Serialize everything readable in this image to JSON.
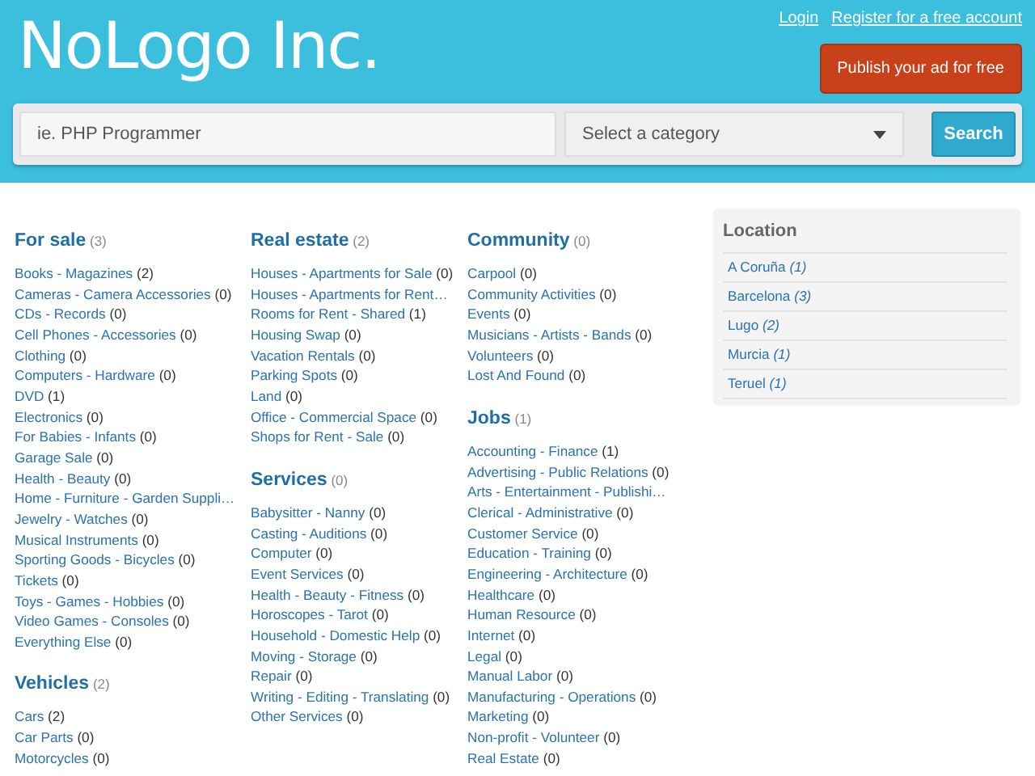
{
  "header": {
    "logo": "NoLogo Inc.",
    "links": [
      "Login",
      "Register for a free account"
    ],
    "publish_button": "Publish your ad for free"
  },
  "search": {
    "placeholder": "ie. PHP Programmer",
    "category": "Select a category",
    "button": "Search"
  },
  "columns": [
    {
      "sections": [
        {
          "title": "For sale",
          "count": "(3)",
          "items": [
            {
              "label": "Books - Magazines",
              "count": "(2)"
            },
            {
              "label": "Cameras - Camera Accessories",
              "count": "(0)"
            },
            {
              "label": "CDs - Records",
              "count": "(0)"
            },
            {
              "label": "Cell Phones - Accessories",
              "count": "(0)"
            },
            {
              "label": "Clothing",
              "count": "(0)"
            },
            {
              "label": "Computers - Hardware",
              "count": "(0)"
            },
            {
              "label": "DVD",
              "count": "(1)"
            },
            {
              "label": "Electronics",
              "count": "(0)"
            },
            {
              "label": "For Babies - Infants",
              "count": "(0)"
            },
            {
              "label": "Garage Sale",
              "count": "(0)"
            },
            {
              "label": "Health - Beauty",
              "count": "(0)"
            },
            {
              "label": "Home - Furniture - Garden Suppli…"
            },
            {
              "label": "Jewelry - Watches",
              "count": "(0)"
            },
            {
              "label": "Musical Instruments",
              "count": "(0)"
            },
            {
              "label": "Sporting Goods - Bicycles",
              "count": "(0)"
            },
            {
              "label": "Tickets",
              "count": "(0)"
            },
            {
              "label": "Toys - Games - Hobbies",
              "count": "(0)"
            },
            {
              "label": "Video Games - Consoles",
              "count": "(0)"
            },
            {
              "label": "Everything Else",
              "count": "(0)"
            }
          ]
        },
        {
          "title": "Vehicles",
          "count": "(2)",
          "items": [
            {
              "label": "Cars",
              "count": "(2)"
            },
            {
              "label": "Car Parts",
              "count": "(0)"
            },
            {
              "label": "Motorcycles",
              "count": "(0)"
            }
          ]
        }
      ]
    },
    {
      "sections": [
        {
          "title": "Real estate",
          "count": "(2)",
          "items": [
            {
              "label": "Houses - Apartments for Sale",
              "count": "(0)"
            },
            {
              "label": "Houses - Apartments for Rent…"
            },
            {
              "label": "Rooms for Rent - Shared",
              "count": "(1)"
            },
            {
              "label": "Housing Swap",
              "count": "(0)"
            },
            {
              "label": "Vacation Rentals",
              "count": "(0)"
            },
            {
              "label": "Parking Spots",
              "count": "(0)"
            },
            {
              "label": "Land",
              "count": "(0)"
            },
            {
              "label": "Office - Commercial Space",
              "count": "(0)"
            },
            {
              "label": "Shops for Rent - Sale",
              "count": "(0)"
            }
          ]
        },
        {
          "title": "Services",
          "count": "(0)",
          "items": [
            {
              "label": "Babysitter - Nanny",
              "count": "(0)"
            },
            {
              "label": "Casting - Auditions",
              "count": "(0)"
            },
            {
              "label": "Computer",
              "count": "(0)"
            },
            {
              "label": "Event Services",
              "count": "(0)"
            },
            {
              "label": "Health - Beauty - Fitness",
              "count": "(0)"
            },
            {
              "label": "Horoscopes - Tarot",
              "count": "(0)"
            },
            {
              "label": "Household - Domestic Help",
              "count": "(0)"
            },
            {
              "label": "Moving - Storage",
              "count": "(0)"
            },
            {
              "label": "Repair",
              "count": "(0)"
            },
            {
              "label": "Writing - Editing - Translating",
              "count": "(0)"
            },
            {
              "label": "Other Services",
              "count": "(0)"
            }
          ]
        }
      ]
    },
    {
      "sections": [
        {
          "title": "Community",
          "count": "(0)",
          "items": [
            {
              "label": "Carpool",
              "count": "(0)"
            },
            {
              "label": "Community Activities",
              "count": "(0)"
            },
            {
              "label": "Events",
              "count": "(0)"
            },
            {
              "label": "Musicians - Artists - Bands",
              "count": "(0)"
            },
            {
              "label": "Volunteers",
              "count": "(0)"
            },
            {
              "label": "Lost And Found",
              "count": "(0)"
            }
          ]
        },
        {
          "title": "Jobs",
          "count": "(1)",
          "items": [
            {
              "label": "Accounting - Finance",
              "count": "(1)"
            },
            {
              "label": "Advertising - Public Relations",
              "count": "(0)"
            },
            {
              "label": "Arts - Entertainment - Publishi…"
            },
            {
              "label": "Clerical - Administrative",
              "count": "(0)"
            },
            {
              "label": "Customer Service",
              "count": "(0)"
            },
            {
              "label": "Education - Training",
              "count": "(0)"
            },
            {
              "label": "Engineering - Architecture",
              "count": "(0)"
            },
            {
              "label": "Healthcare",
              "count": "(0)"
            },
            {
              "label": "Human Resource",
              "count": "(0)"
            },
            {
              "label": "Internet",
              "count": "(0)"
            },
            {
              "label": "Legal",
              "count": "(0)"
            },
            {
              "label": "Manual Labor",
              "count": "(0)"
            },
            {
              "label": "Manufacturing - Operations",
              "count": "(0)"
            },
            {
              "label": "Marketing",
              "count": "(0)"
            },
            {
              "label": "Non-profit - Volunteer",
              "count": "(0)"
            },
            {
              "label": "Real Estate",
              "count": "(0)"
            }
          ]
        }
      ]
    }
  ],
  "location": {
    "title": "Location",
    "items": [
      {
        "label": "A Coruña",
        "count": "(1)"
      },
      {
        "label": "Barcelona",
        "count": "(3)"
      },
      {
        "label": "Lugo",
        "count": "(2)"
      },
      {
        "label": "Murcia",
        "count": "(1)"
      },
      {
        "label": "Teruel",
        "count": "(1)"
      }
    ]
  }
}
